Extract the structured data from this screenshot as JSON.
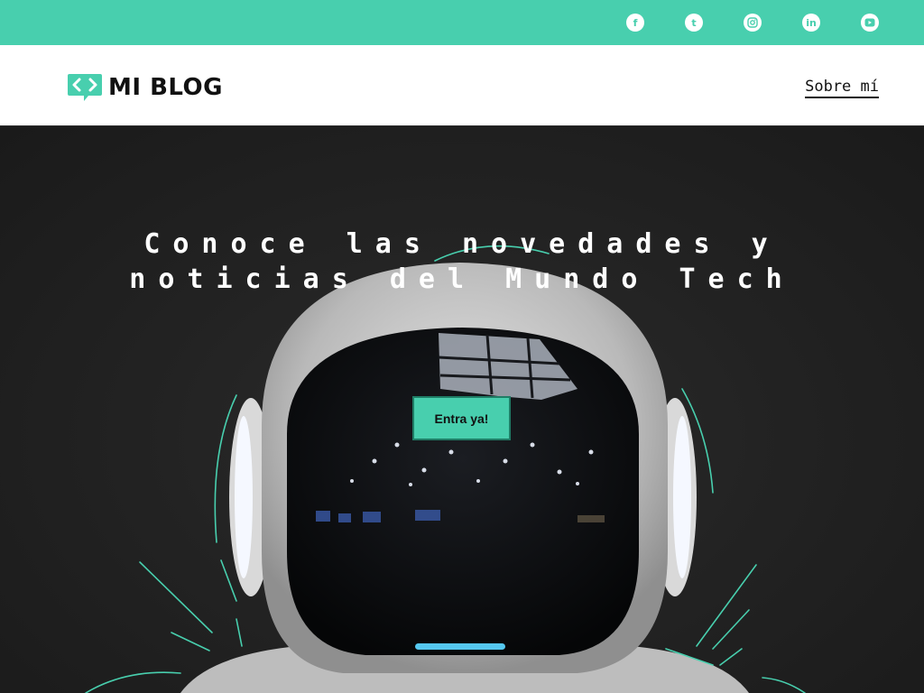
{
  "topbar": {
    "color": "#48cfae",
    "social": [
      {
        "name": "facebook-icon",
        "glyph": "f"
      },
      {
        "name": "tumblr-icon",
        "glyph": "t"
      },
      {
        "name": "instagram-icon",
        "glyph": ""
      },
      {
        "name": "linkedin-icon",
        "glyph": "in"
      },
      {
        "name": "youtube-icon",
        "glyph": ""
      }
    ]
  },
  "header": {
    "logo_text": "MI BLOG",
    "logo_icon": "code-brackets-icon",
    "nav": {
      "about_label": "Sobre mí"
    }
  },
  "hero": {
    "title_line1": "Conoce las novedades y",
    "title_line2": "noticias del Mundo Tech",
    "cta_label": "Entra ya!",
    "accent_color": "#48cfae"
  }
}
